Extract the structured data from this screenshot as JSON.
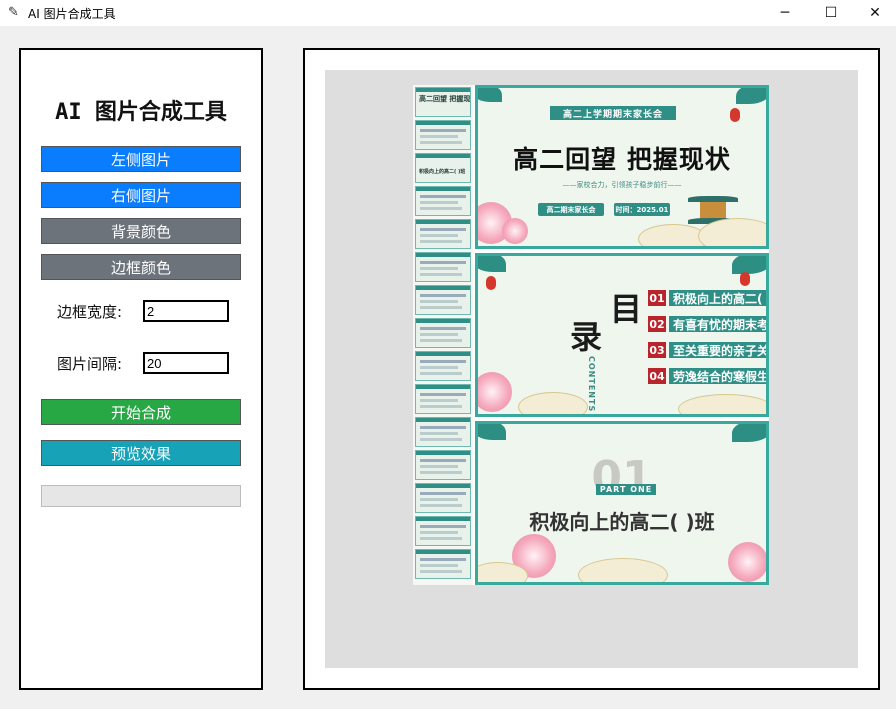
{
  "window": {
    "title": "AI 图片合成工具",
    "controls": {
      "minimize": "─",
      "maximize": "☐",
      "close": "✕"
    }
  },
  "sidebar": {
    "heading": "AI 图片合成工具",
    "buttons": {
      "left_image": "左侧图片",
      "right_image": "右侧图片",
      "bg_color": "背景颜色",
      "border_color": "边框颜色",
      "start": "开始合成",
      "preview": "预览效果"
    },
    "fields": {
      "border_width": {
        "label": "边框宽度:",
        "value": "2"
      },
      "image_gap": {
        "label": "图片间隔:",
        "value": "20"
      }
    },
    "progress": 0
  },
  "thumbnails": {
    "first_title": "高二回望 把握现状",
    "third_title": "积极向上的高二( )班"
  },
  "slides": {
    "cover": {
      "banner": "高二上学期期末家长会",
      "title": "高二回望 把握现状",
      "subtitle": "——家校合力，引领孩子稳步前行——",
      "tag_left": "高二期末家长会",
      "tag_right": "时间：2025.01"
    },
    "toc": {
      "char_top": "目",
      "char_bottom": "录",
      "contents_label": "CONTENTS",
      "items": [
        {
          "num": "01",
          "text": "积极向上的高二( )班"
        },
        {
          "num": "02",
          "text": "有喜有忧的期末考试"
        },
        {
          "num": "03",
          "text": "至关重要的亲子关系"
        },
        {
          "num": "04",
          "text": "劳逸结合的寒假生活"
        }
      ]
    },
    "section": {
      "number": "01",
      "part_label": "PART ONE",
      "title": "积极向上的高二( )班"
    }
  },
  "colors": {
    "blue_button": "#0a7dff",
    "gray_button": "#6c737b",
    "green_button": "#28a745",
    "cyan_button": "#17a2b8",
    "slide_teal": "#2f8f86",
    "slide_red": "#b8252d"
  }
}
